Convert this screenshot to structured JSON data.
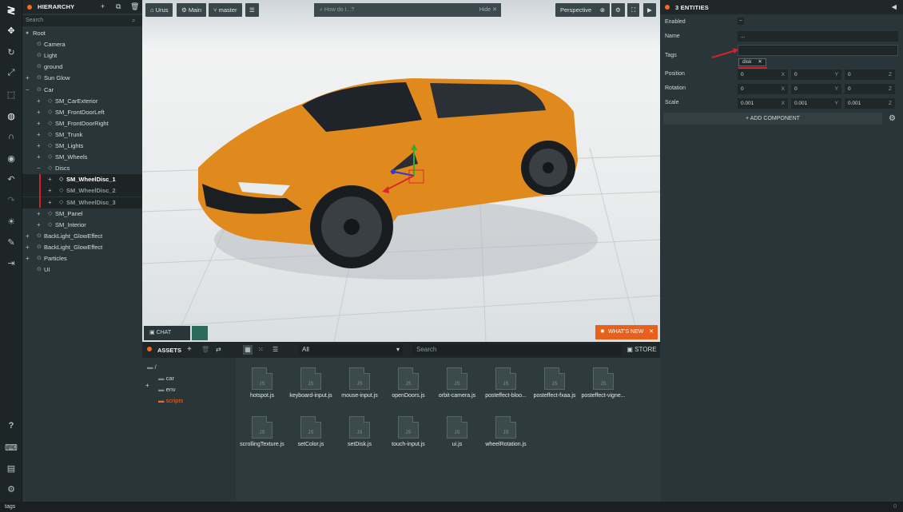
{
  "hierarchy": {
    "title": "HIERARCHY",
    "search_placeholder": "Search",
    "items": [
      {
        "label": "Root",
        "depth": 0,
        "exp": ""
      },
      {
        "label": "Camera",
        "depth": 1,
        "exp": ""
      },
      {
        "label": "Light",
        "depth": 1,
        "exp": ""
      },
      {
        "label": "ground",
        "depth": 1,
        "exp": ""
      },
      {
        "label": "Sun Glow",
        "depth": 1,
        "exp": "+"
      },
      {
        "label": "Car",
        "depth": 1,
        "exp": "−"
      },
      {
        "label": "SM_CarExterior",
        "depth": 2,
        "exp": "+"
      },
      {
        "label": "SM_FrontDoorLeft",
        "depth": 2,
        "exp": "+"
      },
      {
        "label": "SM_FrontDoorRight",
        "depth": 2,
        "exp": "+"
      },
      {
        "label": "SM_Trunk",
        "depth": 2,
        "exp": "+"
      },
      {
        "label": "SM_Lights",
        "depth": 2,
        "exp": "+"
      },
      {
        "label": "SM_Wheels",
        "depth": 2,
        "exp": "+"
      },
      {
        "label": "Discs",
        "depth": 2,
        "exp": "−"
      },
      {
        "label": "SM_WheelDisc_1",
        "depth": 3,
        "exp": "+",
        "sel": 1
      },
      {
        "label": "SM_WheelDisc_2",
        "depth": 3,
        "exp": "+",
        "sel": 2
      },
      {
        "label": "SM_WheelDisc_3",
        "depth": 3,
        "exp": "+",
        "sel": 2
      },
      {
        "label": "SM_Panel",
        "depth": 2,
        "exp": "+"
      },
      {
        "label": "SM_Interior",
        "depth": 2,
        "exp": "+"
      },
      {
        "label": "BackLight_GlowEffect",
        "depth": 1,
        "exp": "+"
      },
      {
        "label": "BackLight_GlowEffect",
        "depth": 1,
        "exp": "+"
      },
      {
        "label": "Particles",
        "depth": 1,
        "exp": "+"
      },
      {
        "label": "UI",
        "depth": 1,
        "exp": ""
      }
    ]
  },
  "viewport": {
    "project": "Urus",
    "scene": "Main",
    "branch": "master",
    "search_placeholder": "How do I...?",
    "hide": "Hide",
    "camera": "Perspective",
    "chat": "CHAT",
    "whats_new": "WHAT'S NEW"
  },
  "assets": {
    "title": "ASSETS",
    "filter": "All",
    "search_placeholder": "Search",
    "store": "STORE",
    "folders": [
      "/",
      "car",
      "env",
      "scripts"
    ],
    "files": [
      "hotspot.js",
      "keyboard-input.js",
      "mouse-input.js",
      "openDoors.js",
      "orbit-camera.js",
      "posteffect-bloo...",
      "posteffect-fxaa.js",
      "posteffect-vigne...",
      "scrollingTexture.js",
      "setColor.js",
      "setDisk.js",
      "touch-input.js",
      "ui.js",
      "wheelRotation.js"
    ],
    "file_icon": "JS"
  },
  "inspector": {
    "title": "3 ENTITIES",
    "enabled_label": "Enabled",
    "enabled_value": "–",
    "name_label": "Name",
    "name_value": "...",
    "tags_label": "Tags",
    "tag": "disk",
    "position_label": "Position",
    "rotation_label": "Rotation",
    "scale_label": "Scale",
    "position": [
      "0",
      "0",
      "0"
    ],
    "rotation": [
      "0",
      "0",
      "0"
    ],
    "scale": [
      "0.001",
      "0.001",
      "0.001"
    ],
    "add_component": "ADD COMPONENT"
  },
  "status": {
    "text": "tags",
    "right": "0"
  },
  "colors": {
    "accent": "#f26a21",
    "panel": "#293538",
    "annotation": "#d6212a"
  }
}
